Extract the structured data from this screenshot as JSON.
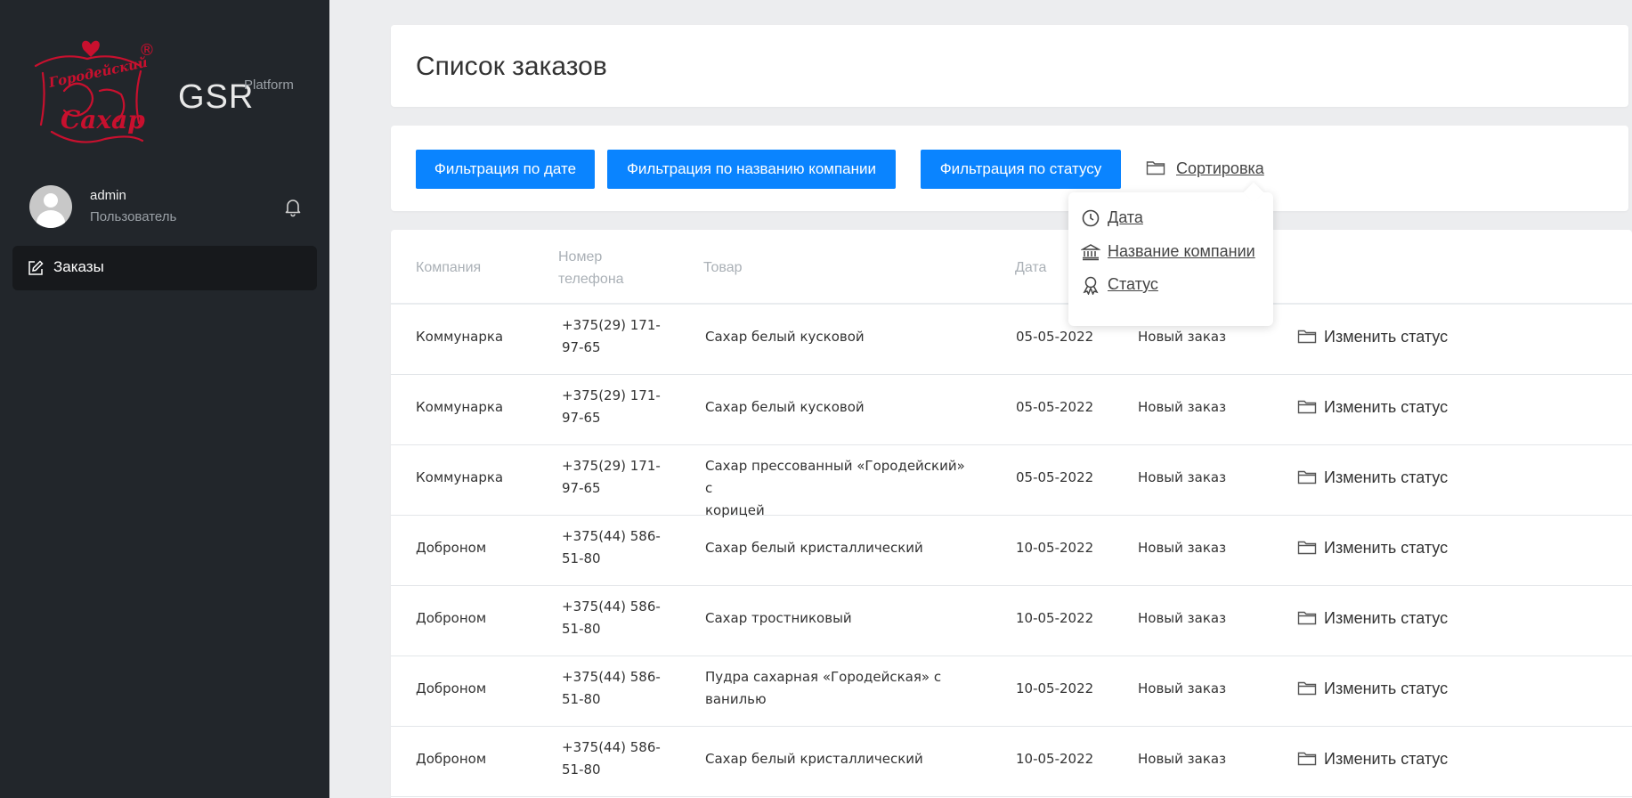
{
  "sidebar": {
    "brand": "GSR",
    "brand_sub": "Platform",
    "user_name": "admin",
    "user_role": "Пользователь",
    "nav": [
      {
        "label": "Заказы",
        "icon": "edit-icon"
      }
    ]
  },
  "header": {
    "title": "Список заказов"
  },
  "filters": {
    "by_date": "Фильтрация по дате",
    "by_company": "Фильтрация по названию компании",
    "by_status": "Фильтрация по статусу",
    "sort_label": "Сортировка"
  },
  "sort_menu": {
    "date": "Дата",
    "company": "Название компании",
    "status": "Статус"
  },
  "table": {
    "headers": {
      "company": "Компания",
      "phone_line1": "Номер",
      "phone_line2": "телефона",
      "product": "Товар",
      "date": "Дата"
    },
    "rows": [
      {
        "company": "Коммунарка",
        "phone1": "+375(29) 171-",
        "phone2": "97-65",
        "product1": "Сахар белый кусковой",
        "product2": "",
        "date": "05-05-2022",
        "status": "Новый заказ",
        "action": "Изменить статус"
      },
      {
        "company": "Коммунарка",
        "phone1": "+375(29) 171-",
        "phone2": "97-65",
        "product1": "Сахар белый кусковой",
        "product2": "",
        "date": "05-05-2022",
        "status": "Новый заказ",
        "action": "Изменить статус"
      },
      {
        "company": "Коммунарка",
        "phone1": "+375(29) 171-",
        "phone2": "97-65",
        "product1": "Сахар прессованный «Городейский» с",
        "product2": "корицей",
        "date": "05-05-2022",
        "status": "Новый заказ",
        "action": "Изменить статус"
      },
      {
        "company": "Доброном",
        "phone1": "+375(44) 586-",
        "phone2": "51-80",
        "product1": "Сахар белый кристаллический",
        "product2": "",
        "date": "10-05-2022",
        "status": "Новый заказ",
        "action": "Изменить статус"
      },
      {
        "company": "Доброном",
        "phone1": "+375(44) 586-",
        "phone2": "51-80",
        "product1": "Сахар тростниковый",
        "product2": "",
        "date": "10-05-2022",
        "status": "Новый заказ",
        "action": "Изменить статус"
      },
      {
        "company": "Доброном",
        "phone1": "+375(44) 586-",
        "phone2": "51-80",
        "product1": "Пудра сахарная «Городейская» с",
        "product2": "ванилью",
        "date": "10-05-2022",
        "status": "Новый заказ",
        "action": "Изменить статус"
      },
      {
        "company": "Доброном",
        "phone1": "+375(44) 586-",
        "phone2": "51-80",
        "product1": "Сахар белый кристаллический",
        "product2": "",
        "date": "10-05-2022",
        "status": "Новый заказ",
        "action": "Изменить статус"
      }
    ]
  },
  "logo": {
    "text_top": "Городейский",
    "text_bottom": "Сахар",
    "registered": "®"
  },
  "colors": {
    "sidebar": "#22262b",
    "primary": "#0a84ff",
    "logo_red": "#c8102e"
  }
}
